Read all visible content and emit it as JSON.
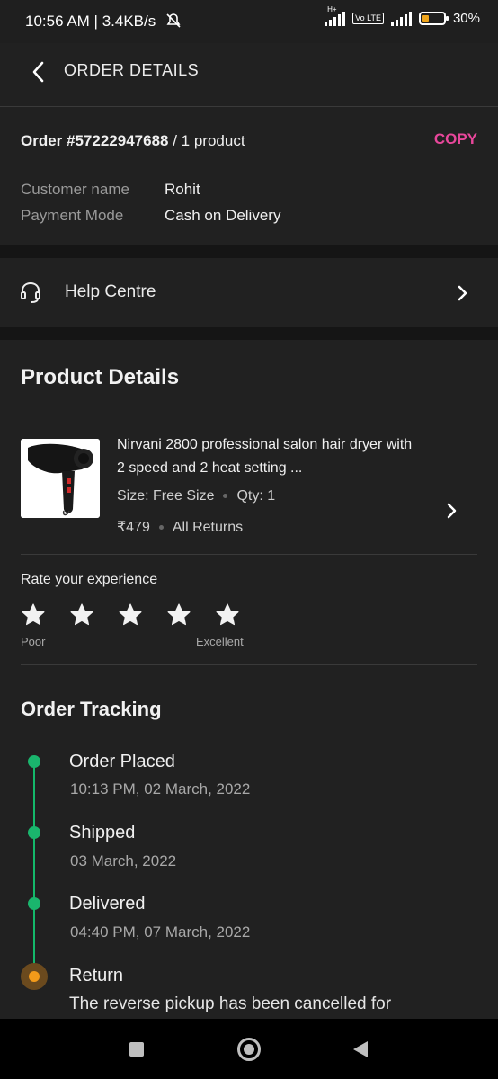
{
  "status_bar": {
    "time": "10:56 AM | 3.4KB/s",
    "network_label": "H+",
    "volte_label": "Vo LTE",
    "battery_percent": "30%",
    "battery_level": 0.3
  },
  "header": {
    "title": "ORDER DETAILS"
  },
  "order": {
    "number": "Order #57222947688",
    "count": "/ 1 product",
    "copy_label": "COPY",
    "customer_label": "Customer name",
    "customer_value": "Rohit",
    "payment_label": "Payment Mode",
    "payment_value": "Cash on Delivery"
  },
  "help": {
    "label": "Help Centre"
  },
  "product": {
    "section_title": "Product Details",
    "name": "Nirvani 2800 professional salon hair dryer with 2 speed and 2 heat setting ...",
    "size": "Size: Free Size",
    "qty": "Qty: 1",
    "price": "₹479",
    "returns": "All Returns"
  },
  "rating": {
    "title": "Rate your experience",
    "low_label": "Poor",
    "high_label": "Excellent",
    "stars": 5
  },
  "tracking": {
    "title": "Order Tracking",
    "steps": [
      {
        "label": "Order Placed",
        "date": "10:13 PM, 02 March, 2022"
      },
      {
        "label": "Shipped",
        "date": "03 March, 2022"
      },
      {
        "label": "Delivered",
        "date": "04:40 PM, 07 March, 2022"
      },
      {
        "label": "Return",
        "desc": "The reverse pickup has been cancelled for"
      }
    ]
  },
  "colors": {
    "accent": "#e8479b",
    "track_green": "#1ab56d",
    "track_orange": "#f39a1a",
    "background": "#212121"
  },
  "icons": [
    "muted-bell-icon",
    "signal-icon",
    "battery-icon",
    "back-arrow-icon",
    "headset-icon",
    "chevron-right-icon",
    "star-icon",
    "nav-square-icon",
    "nav-home-icon",
    "nav-back-icon"
  ]
}
